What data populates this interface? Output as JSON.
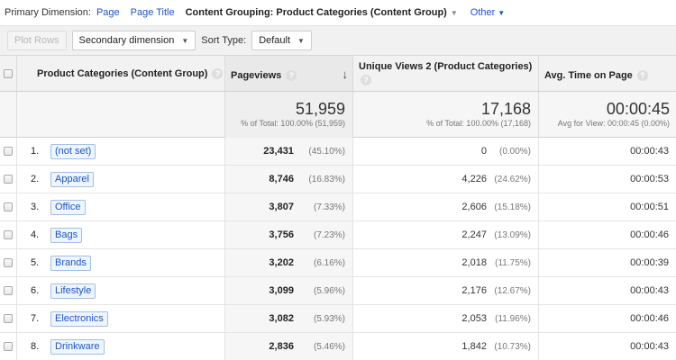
{
  "dimension_bar": {
    "label": "Primary Dimension:",
    "options": [
      "Page",
      "Page Title"
    ],
    "active": "Content Grouping: Product Categories (Content Group)",
    "other": "Other"
  },
  "toolbar": {
    "plot_rows": "Plot Rows",
    "secondary_dimension": "Secondary dimension",
    "sort_type_label": "Sort Type:",
    "sort_type_value": "Default"
  },
  "table": {
    "headers": {
      "category": "Product Categories (Content Group)",
      "pageviews": "Pageviews",
      "unique_views": "Unique Views 2 (Product Categories)",
      "avg_time": "Avg. Time on Page"
    },
    "totals": {
      "pageviews": "51,959",
      "pageviews_sub": "% of Total: 100.00% (51,959)",
      "unique_views": "17,168",
      "unique_views_sub": "% of Total: 100.00% (17,168)",
      "avg_time": "00:00:45",
      "avg_time_sub": "Avg for View: 00:00:45 (0.00%)"
    },
    "rows": [
      {
        "num": "1.",
        "category": "(not set)",
        "pageviews": "23,431",
        "pv_pct": "(45.10%)",
        "unique": "0",
        "uv_pct": "(0.00%)",
        "avg_time": "00:00:43"
      },
      {
        "num": "2.",
        "category": "Apparel",
        "pageviews": "8,746",
        "pv_pct": "(16.83%)",
        "unique": "4,226",
        "uv_pct": "(24.62%)",
        "avg_time": "00:00:53"
      },
      {
        "num": "3.",
        "category": "Office",
        "pageviews": "3,807",
        "pv_pct": "(7.33%)",
        "unique": "2,606",
        "uv_pct": "(15.18%)",
        "avg_time": "00:00:51"
      },
      {
        "num": "4.",
        "category": "Bags",
        "pageviews": "3,756",
        "pv_pct": "(7.23%)",
        "unique": "2,247",
        "uv_pct": "(13.09%)",
        "avg_time": "00:00:46"
      },
      {
        "num": "5.",
        "category": "Brands",
        "pageviews": "3,202",
        "pv_pct": "(6.16%)",
        "unique": "2,018",
        "uv_pct": "(11.75%)",
        "avg_time": "00:00:39"
      },
      {
        "num": "6.",
        "category": "Lifestyle",
        "pageviews": "3,099",
        "pv_pct": "(5.96%)",
        "unique": "2,176",
        "uv_pct": "(12.67%)",
        "avg_time": "00:00:43"
      },
      {
        "num": "7.",
        "category": "Electronics",
        "pageviews": "3,082",
        "pv_pct": "(5.93%)",
        "unique": "2,053",
        "uv_pct": "(11.96%)",
        "avg_time": "00:00:46"
      },
      {
        "num": "8.",
        "category": "Drinkware",
        "pageviews": "2,836",
        "pv_pct": "(5.46%)",
        "unique": "1,842",
        "uv_pct": "(10.73%)",
        "avg_time": "00:00:43"
      }
    ]
  },
  "icons": {
    "help": "?",
    "sort_desc": "↓",
    "dropdown": "▼"
  }
}
